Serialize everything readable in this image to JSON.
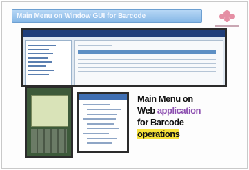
{
  "slide": {
    "title": "Main Menu on Window GUI for Barcode"
  },
  "caption": {
    "line1": "Main Menu on",
    "line2_a": "Web ",
    "line2_b": "application",
    "line3": "for Barcode",
    "line4": "operations"
  },
  "colors": {
    "banner": "#9fc8f0",
    "highlight_purple": "#8c4fb0",
    "highlight_yellow": "#f6e23a"
  }
}
